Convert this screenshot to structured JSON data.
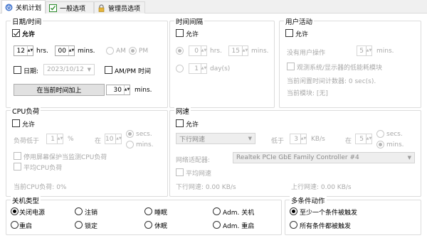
{
  "tabs": [
    {
      "label": "关机计划",
      "icon": "power-icon"
    },
    {
      "label": "一般选项",
      "icon": "checkbox-icon"
    },
    {
      "label": "管理员选项",
      "icon": "lock-icon"
    }
  ],
  "datetime": {
    "title": "日期/时间",
    "allow": "允许",
    "hours": "12",
    "hrs": "hrs.",
    "minutes": "00",
    "mins": "mins.",
    "am": "AM",
    "pm": "PM",
    "date_label": "日期:",
    "date_value": "2023/10/12",
    "ampm_time": "AM/PM 时间",
    "add_button": "在当前时间加上",
    "add_minutes": "30",
    "add_mins": "mins."
  },
  "interval": {
    "title": "时间间隔",
    "allow": "允许",
    "hours": "0",
    "hrs": "hrs.",
    "minutes": "15",
    "mins": "mins.",
    "days": "1",
    "days_unit": "day(s)"
  },
  "activity": {
    "title": "用户活动",
    "allow": "允许",
    "no_user": "没有用户操作",
    "minutes": "5",
    "mins": "mins.",
    "observe": "观测系统/显示器的低能耗模块",
    "idle_counter": "当前闲置时间计数器: 0 sec(s).",
    "current_module": "当前模块: [无]"
  },
  "cpu": {
    "title": "CPU负荷",
    "allow": "允许",
    "load_below": "负荷低于",
    "percent": "1",
    "percent_unit": "%",
    "in": "在",
    "secs_val": "10",
    "secs": "secs.",
    "mins": "mins.",
    "screensaver": "停用屏幕保护当监测CPU负荷",
    "average": "平均CPU负荷",
    "current": "当前CPU负荷: 0%"
  },
  "net": {
    "title": "网速",
    "allow": "允许",
    "direction": "下行网速",
    "below": "低于",
    "kbs_val": "3",
    "kbs": "KB/s",
    "in": "在",
    "secs_val": "5",
    "secs": "secs.",
    "mins": "mins.",
    "adapter_label": "网络适配器:",
    "adapter": "Realtek PCIe GbE Family Controller #4",
    "average": "平均网速",
    "down": "下行网速: 0.00 KB/s",
    "up": "上行网速: 0.00 KB/s"
  },
  "shutdown": {
    "title": "关机类型",
    "options": [
      "关闭电源",
      "注销",
      "睡眠",
      "Adm. 关机",
      "重启",
      "锁定",
      "休眠",
      "Adm. 重启"
    ],
    "selected": 0
  },
  "multi": {
    "title": "多条件动作",
    "options": [
      "至少一个条件被触发",
      "所有条件都被触发"
    ],
    "selected": 0
  }
}
